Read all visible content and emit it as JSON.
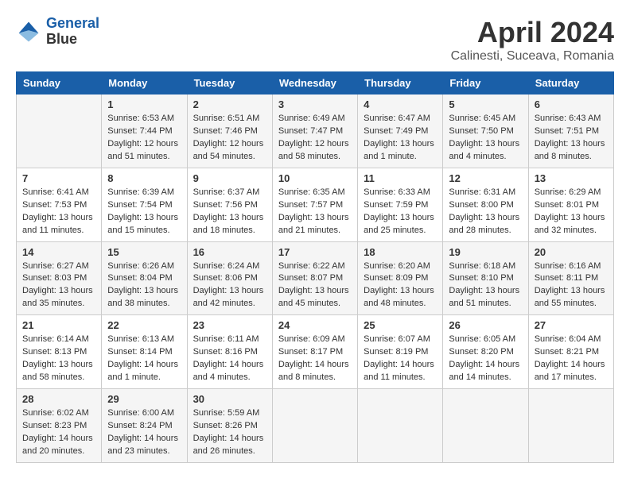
{
  "header": {
    "logo_line1": "General",
    "logo_line2": "Blue",
    "month": "April 2024",
    "location": "Calinesti, Suceava, Romania"
  },
  "weekdays": [
    "Sunday",
    "Monday",
    "Tuesday",
    "Wednesday",
    "Thursday",
    "Friday",
    "Saturday"
  ],
  "weeks": [
    [
      {
        "day": "",
        "sunrise": "",
        "sunset": "",
        "daylight": ""
      },
      {
        "day": "1",
        "sunrise": "Sunrise: 6:53 AM",
        "sunset": "Sunset: 7:44 PM",
        "daylight": "Daylight: 12 hours and 51 minutes."
      },
      {
        "day": "2",
        "sunrise": "Sunrise: 6:51 AM",
        "sunset": "Sunset: 7:46 PM",
        "daylight": "Daylight: 12 hours and 54 minutes."
      },
      {
        "day": "3",
        "sunrise": "Sunrise: 6:49 AM",
        "sunset": "Sunset: 7:47 PM",
        "daylight": "Daylight: 12 hours and 58 minutes."
      },
      {
        "day": "4",
        "sunrise": "Sunrise: 6:47 AM",
        "sunset": "Sunset: 7:49 PM",
        "daylight": "Daylight: 13 hours and 1 minute."
      },
      {
        "day": "5",
        "sunrise": "Sunrise: 6:45 AM",
        "sunset": "Sunset: 7:50 PM",
        "daylight": "Daylight: 13 hours and 4 minutes."
      },
      {
        "day": "6",
        "sunrise": "Sunrise: 6:43 AM",
        "sunset": "Sunset: 7:51 PM",
        "daylight": "Daylight: 13 hours and 8 minutes."
      }
    ],
    [
      {
        "day": "7",
        "sunrise": "Sunrise: 6:41 AM",
        "sunset": "Sunset: 7:53 PM",
        "daylight": "Daylight: 13 hours and 11 minutes."
      },
      {
        "day": "8",
        "sunrise": "Sunrise: 6:39 AM",
        "sunset": "Sunset: 7:54 PM",
        "daylight": "Daylight: 13 hours and 15 minutes."
      },
      {
        "day": "9",
        "sunrise": "Sunrise: 6:37 AM",
        "sunset": "Sunset: 7:56 PM",
        "daylight": "Daylight: 13 hours and 18 minutes."
      },
      {
        "day": "10",
        "sunrise": "Sunrise: 6:35 AM",
        "sunset": "Sunset: 7:57 PM",
        "daylight": "Daylight: 13 hours and 21 minutes."
      },
      {
        "day": "11",
        "sunrise": "Sunrise: 6:33 AM",
        "sunset": "Sunset: 7:59 PM",
        "daylight": "Daylight: 13 hours and 25 minutes."
      },
      {
        "day": "12",
        "sunrise": "Sunrise: 6:31 AM",
        "sunset": "Sunset: 8:00 PM",
        "daylight": "Daylight: 13 hours and 28 minutes."
      },
      {
        "day": "13",
        "sunrise": "Sunrise: 6:29 AM",
        "sunset": "Sunset: 8:01 PM",
        "daylight": "Daylight: 13 hours and 32 minutes."
      }
    ],
    [
      {
        "day": "14",
        "sunrise": "Sunrise: 6:27 AM",
        "sunset": "Sunset: 8:03 PM",
        "daylight": "Daylight: 13 hours and 35 minutes."
      },
      {
        "day": "15",
        "sunrise": "Sunrise: 6:26 AM",
        "sunset": "Sunset: 8:04 PM",
        "daylight": "Daylight: 13 hours and 38 minutes."
      },
      {
        "day": "16",
        "sunrise": "Sunrise: 6:24 AM",
        "sunset": "Sunset: 8:06 PM",
        "daylight": "Daylight: 13 hours and 42 minutes."
      },
      {
        "day": "17",
        "sunrise": "Sunrise: 6:22 AM",
        "sunset": "Sunset: 8:07 PM",
        "daylight": "Daylight: 13 hours and 45 minutes."
      },
      {
        "day": "18",
        "sunrise": "Sunrise: 6:20 AM",
        "sunset": "Sunset: 8:09 PM",
        "daylight": "Daylight: 13 hours and 48 minutes."
      },
      {
        "day": "19",
        "sunrise": "Sunrise: 6:18 AM",
        "sunset": "Sunset: 8:10 PM",
        "daylight": "Daylight: 13 hours and 51 minutes."
      },
      {
        "day": "20",
        "sunrise": "Sunrise: 6:16 AM",
        "sunset": "Sunset: 8:11 PM",
        "daylight": "Daylight: 13 hours and 55 minutes."
      }
    ],
    [
      {
        "day": "21",
        "sunrise": "Sunrise: 6:14 AM",
        "sunset": "Sunset: 8:13 PM",
        "daylight": "Daylight: 13 hours and 58 minutes."
      },
      {
        "day": "22",
        "sunrise": "Sunrise: 6:13 AM",
        "sunset": "Sunset: 8:14 PM",
        "daylight": "Daylight: 14 hours and 1 minute."
      },
      {
        "day": "23",
        "sunrise": "Sunrise: 6:11 AM",
        "sunset": "Sunset: 8:16 PM",
        "daylight": "Daylight: 14 hours and 4 minutes."
      },
      {
        "day": "24",
        "sunrise": "Sunrise: 6:09 AM",
        "sunset": "Sunset: 8:17 PM",
        "daylight": "Daylight: 14 hours and 8 minutes."
      },
      {
        "day": "25",
        "sunrise": "Sunrise: 6:07 AM",
        "sunset": "Sunset: 8:19 PM",
        "daylight": "Daylight: 14 hours and 11 minutes."
      },
      {
        "day": "26",
        "sunrise": "Sunrise: 6:05 AM",
        "sunset": "Sunset: 8:20 PM",
        "daylight": "Daylight: 14 hours and 14 minutes."
      },
      {
        "day": "27",
        "sunrise": "Sunrise: 6:04 AM",
        "sunset": "Sunset: 8:21 PM",
        "daylight": "Daylight: 14 hours and 17 minutes."
      }
    ],
    [
      {
        "day": "28",
        "sunrise": "Sunrise: 6:02 AM",
        "sunset": "Sunset: 8:23 PM",
        "daylight": "Daylight: 14 hours and 20 minutes."
      },
      {
        "day": "29",
        "sunrise": "Sunrise: 6:00 AM",
        "sunset": "Sunset: 8:24 PM",
        "daylight": "Daylight: 14 hours and 23 minutes."
      },
      {
        "day": "30",
        "sunrise": "Sunrise: 5:59 AM",
        "sunset": "Sunset: 8:26 PM",
        "daylight": "Daylight: 14 hours and 26 minutes."
      },
      {
        "day": "",
        "sunrise": "",
        "sunset": "",
        "daylight": ""
      },
      {
        "day": "",
        "sunrise": "",
        "sunset": "",
        "daylight": ""
      },
      {
        "day": "",
        "sunrise": "",
        "sunset": "",
        "daylight": ""
      },
      {
        "day": "",
        "sunrise": "",
        "sunset": "",
        "daylight": ""
      }
    ]
  ]
}
